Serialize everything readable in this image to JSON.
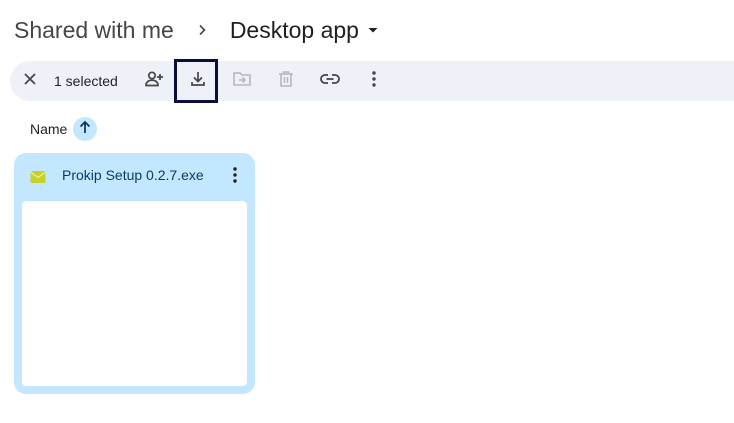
{
  "breadcrumb": {
    "parent": "Shared with me",
    "current": "Desktop app"
  },
  "toolbar": {
    "selected_count": "1 selected",
    "actions": [
      {
        "name": "clear-selection",
        "icon": "close-icon"
      },
      {
        "name": "share",
        "icon": "person-add-icon"
      },
      {
        "name": "download",
        "icon": "download-icon",
        "focused": true
      },
      {
        "name": "move",
        "icon": "drive-file-move-icon",
        "disabled": true
      },
      {
        "name": "delete",
        "icon": "trash-icon",
        "disabled": true
      },
      {
        "name": "copy-link",
        "icon": "link-icon"
      },
      {
        "name": "more-actions",
        "icon": "more-vert-icon"
      }
    ]
  },
  "sort": {
    "label": "Name",
    "direction": "ascending",
    "icon": "arrow-up-icon"
  },
  "files": [
    {
      "name": "Prokip Setup 0.2.7.exe",
      "icon": "executable-file-icon",
      "selected": true
    }
  ],
  "colors": {
    "toolbar_bg": "#eef2f8",
    "selected_card": "#c2e7ff",
    "focus_outline": "#0d0d3d",
    "file_icon": "#c6d22a"
  }
}
